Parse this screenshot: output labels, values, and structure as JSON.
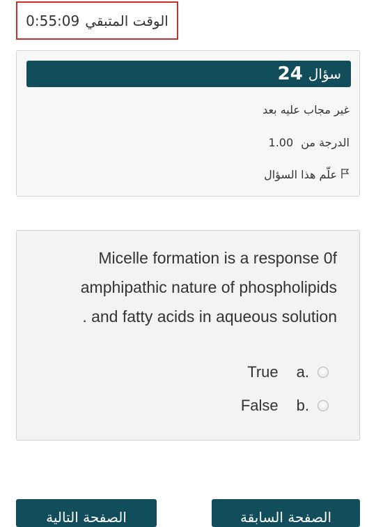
{
  "timer": {
    "label": "الوقت المتبقي",
    "value": "0:55:09"
  },
  "info": {
    "question_word": "سؤال",
    "question_number": "24",
    "status": "غير مجاب عليه بعد",
    "grade_label": "الدرجة من",
    "grade_value": "1.00",
    "flag_label": "علّم هذا السؤال",
    "flag_icon": "flag-icon"
  },
  "question": {
    "lines": [
      "Micelle formation is a response 0f",
      "amphipathic nature of phospholipids",
      ". and fatty acids in aqueous solution"
    ],
    "options": [
      {
        "letter": "a.",
        "text": "True"
      },
      {
        "letter": "b.",
        "text": "False"
      }
    ]
  },
  "nav": {
    "next_label": "الصفحة التالية",
    "prev_label": "الصفحة السابقة"
  },
  "colors": {
    "primary": "#124d5b",
    "timer_border": "#c9302c",
    "card_bg": "#f7f7f7"
  }
}
